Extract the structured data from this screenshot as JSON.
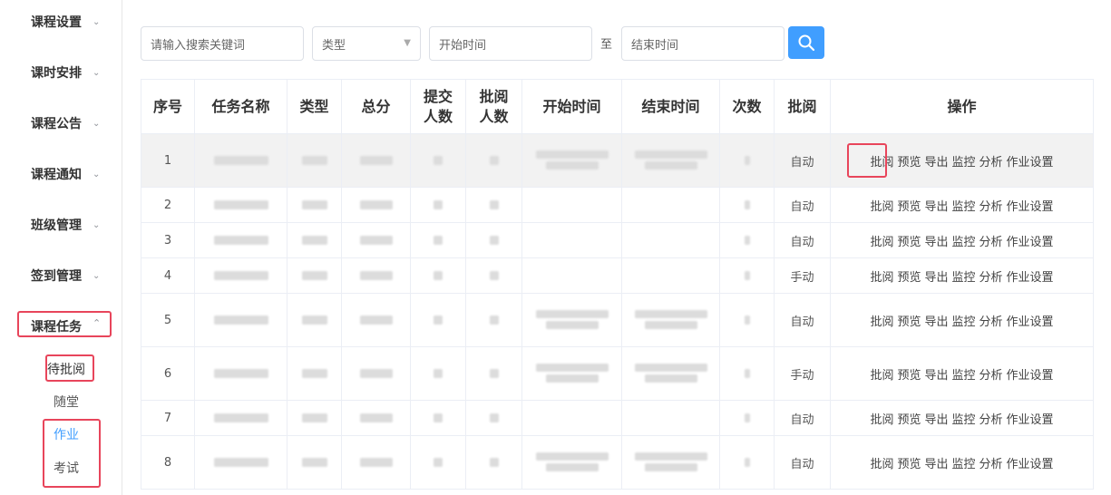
{
  "sidebar": {
    "menus": [
      {
        "label": "课程设置"
      },
      {
        "label": "课时安排"
      },
      {
        "label": "课程公告"
      },
      {
        "label": "课程通知"
      },
      {
        "label": "班级管理"
      },
      {
        "label": "签到管理"
      },
      {
        "label": "课程任务"
      }
    ],
    "submenus": [
      {
        "label": "待批阅"
      },
      {
        "label": "随堂"
      },
      {
        "label": "作业"
      },
      {
        "label": "考试"
      }
    ]
  },
  "toolbar": {
    "search_placeholder": "请输入搜索关键词",
    "type_select": "类型",
    "start_placeholder": "开始时间",
    "separator": "至",
    "end_placeholder": "结束时间"
  },
  "table": {
    "headers": [
      "序号",
      "任务名称",
      "类型",
      "总分",
      "提交人数",
      "批阅人数",
      "开始时间",
      "结束时间",
      "次数",
      "批阅",
      "操作"
    ],
    "actions": [
      "批阅",
      "预览",
      "导出",
      "监控",
      "分析",
      "作业设置"
    ],
    "rows": [
      {
        "no": "1",
        "mode": "自动"
      },
      {
        "no": "2",
        "mode": "自动"
      },
      {
        "no": "3",
        "mode": "自动"
      },
      {
        "no": "4",
        "mode": "手动"
      },
      {
        "no": "5",
        "mode": "自动"
      },
      {
        "no": "6",
        "mode": "手动"
      },
      {
        "no": "7",
        "mode": "自动"
      },
      {
        "no": "8",
        "mode": "自动"
      }
    ]
  },
  "colors": {
    "accent": "#409eff",
    "highlight_box": "#e8455b"
  }
}
